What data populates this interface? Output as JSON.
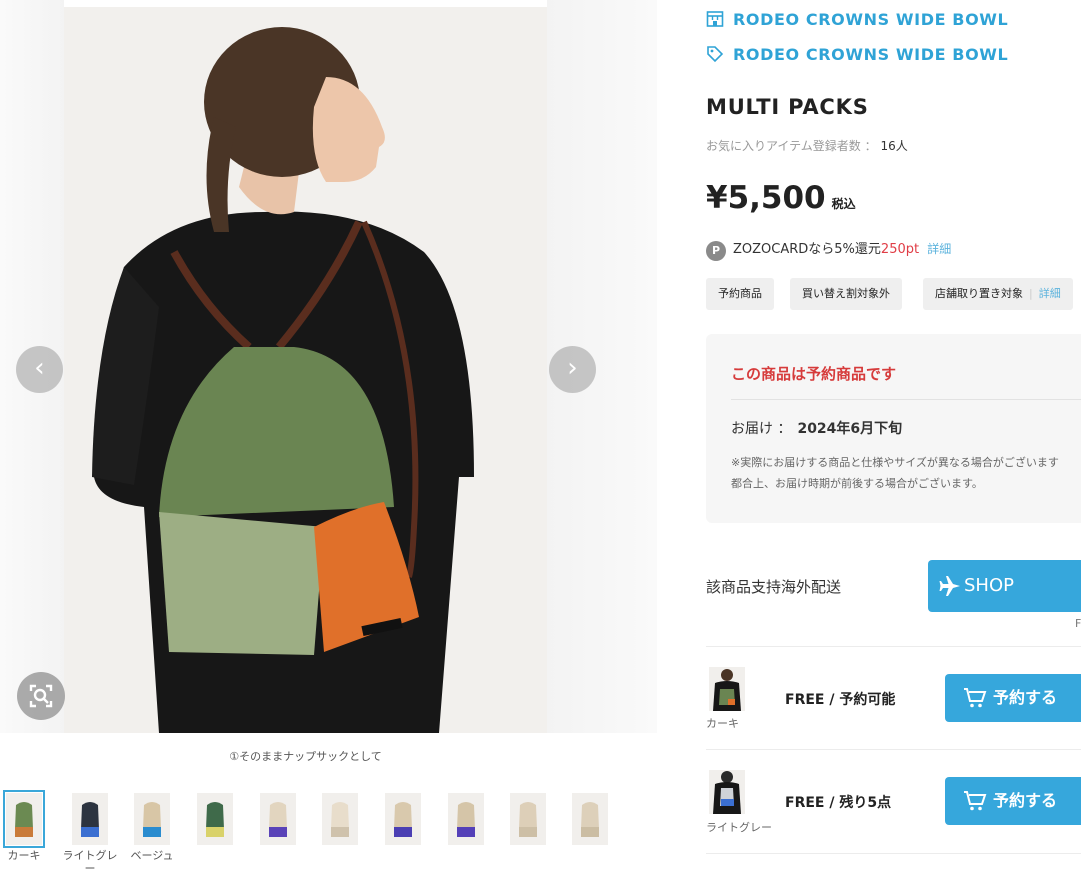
{
  "gallery": {
    "caption": "①そのままナップサックとして",
    "prev_icon": "chevron-left-icon",
    "next_icon": "chevron-right-icon",
    "lens_icon": "image-search-icon",
    "thumbnails": [
      {
        "label": "カーキ",
        "selected": true,
        "bag": "#6b8a52",
        "bottom": "#c97b3a"
      },
      {
        "label": "ライトグレー",
        "selected": false,
        "bag": "#2c3440",
        "bottom": "#3b6fd1"
      },
      {
        "label": "ベージュ",
        "selected": false,
        "bag": "#d8c6a6",
        "bottom": "#2a8ccf"
      },
      {
        "label": "",
        "selected": false,
        "bag": "#3f6a4a",
        "bottom": "#d9d26a"
      },
      {
        "label": "",
        "selected": false,
        "bag": "#e2d5bf",
        "bottom": "#5a43b8"
      },
      {
        "label": "",
        "selected": false,
        "bag": "#e8ddcb",
        "bottom": "#cfc2ac"
      },
      {
        "label": "",
        "selected": false,
        "bag": "#d9c9ad",
        "bottom": "#4b3fb3"
      },
      {
        "label": "",
        "selected": false,
        "bag": "#d5c5a8",
        "bottom": "#5440b8"
      },
      {
        "label": "",
        "selected": false,
        "bag": "#ddcfb8",
        "bottom": "#cdbfa6"
      },
      {
        "label": "",
        "selected": false,
        "bag": "#ddd0ba",
        "bottom": "#cbbda3"
      }
    ]
  },
  "shop": {
    "store_name": "RODEO CROWNS WIDE BOWL",
    "brand_name": "RODEO CROWNS WIDE BOWL"
  },
  "product": {
    "name": "MULTI PACKS",
    "favorites_label": "お気に入りアイテム登録者数 ：",
    "favorites_count": "16人",
    "price": "¥5,500",
    "tax_label": "税込"
  },
  "points": {
    "badge": "P",
    "text": "ZOZOCARDなら5%還元",
    "amount": "250pt",
    "detail": "詳細"
  },
  "tags": {
    "preorder": "予約商品",
    "no_exchange": "買い替え割対象外",
    "store_hold": "店舗取り置き対象",
    "store_hold_detail": "詳細"
  },
  "reservation": {
    "title": "この商品は予約商品です",
    "delivery_label": "お届け ：",
    "delivery_date": "2024年6月下旬",
    "note_line1": "※実際にお届けする商品と仕様やサイズが異なる場合がございます",
    "note_line2": "都合上、お届け時期が前後する場合がございます。"
  },
  "overseas": {
    "label": "該商品支持海外配送",
    "button": "SHOP",
    "sub": "F"
  },
  "variants": [
    {
      "color": "カーキ",
      "size": "FREE",
      "status": "予約可能",
      "button": "予約する"
    },
    {
      "color": "ライトグレー",
      "size": "FREE",
      "status": "残り5点",
      "button": "予約する"
    }
  ],
  "colors": {
    "accent": "#2fa3d6",
    "button": "#36a7dc",
    "alert": "#d63b3b",
    "points_red": "#e03d46"
  }
}
